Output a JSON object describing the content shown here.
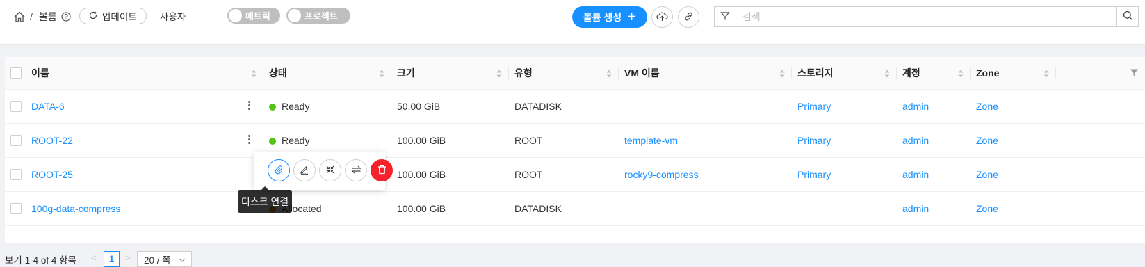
{
  "breadcrumb": {
    "separator": "/",
    "current": "볼륨"
  },
  "toolbar": {
    "update_label": "업데이트",
    "filter_select_value": "사용자",
    "toggle_metric_label": "메트릭",
    "toggle_project_label": "프로젝트",
    "create_label": "볼륨 생성"
  },
  "search": {
    "placeholder": "검색"
  },
  "table": {
    "headers": [
      "이름",
      "상태",
      "크기",
      "유형",
      "VM 이름",
      "스토리지",
      "계정",
      "Zone"
    ],
    "rows": [
      {
        "name": "DATA-6",
        "status": "Ready",
        "size": "50.00 GiB",
        "type": "DATADISK",
        "vm": "",
        "storage": "Primary",
        "account": "admin",
        "zone": "Zone"
      },
      {
        "name": "ROOT-22",
        "status": "Ready",
        "size": "100.00 GiB",
        "type": "ROOT",
        "vm": "template-vm",
        "storage": "Primary",
        "account": "admin",
        "zone": "Zone"
      },
      {
        "name": "ROOT-25",
        "status": "",
        "size": "100.00 GiB",
        "type": "ROOT",
        "vm": "rocky9-compress",
        "storage": "Primary",
        "account": "admin",
        "zone": "Zone"
      },
      {
        "name": "100g-data-compress",
        "status": "Allocated",
        "size": "100.00 GiB",
        "type": "DATADISK",
        "vm": "",
        "storage": "",
        "account": "admin",
        "zone": "Zone"
      }
    ]
  },
  "popover": {
    "tooltip": "디스크 연결",
    "actions": [
      "attach-icon",
      "edit-icon",
      "resize-icon",
      "migrate-icon",
      "delete-icon"
    ]
  },
  "pagination": {
    "total": "보기 1-4 of 4 항목",
    "current_page": "1",
    "page_size": "20 / 쪽",
    "prev": "<",
    "next": ">"
  },
  "colors": {
    "accent": "#1890ff",
    "ready": "#52c41a",
    "danger": "#f5222d"
  }
}
